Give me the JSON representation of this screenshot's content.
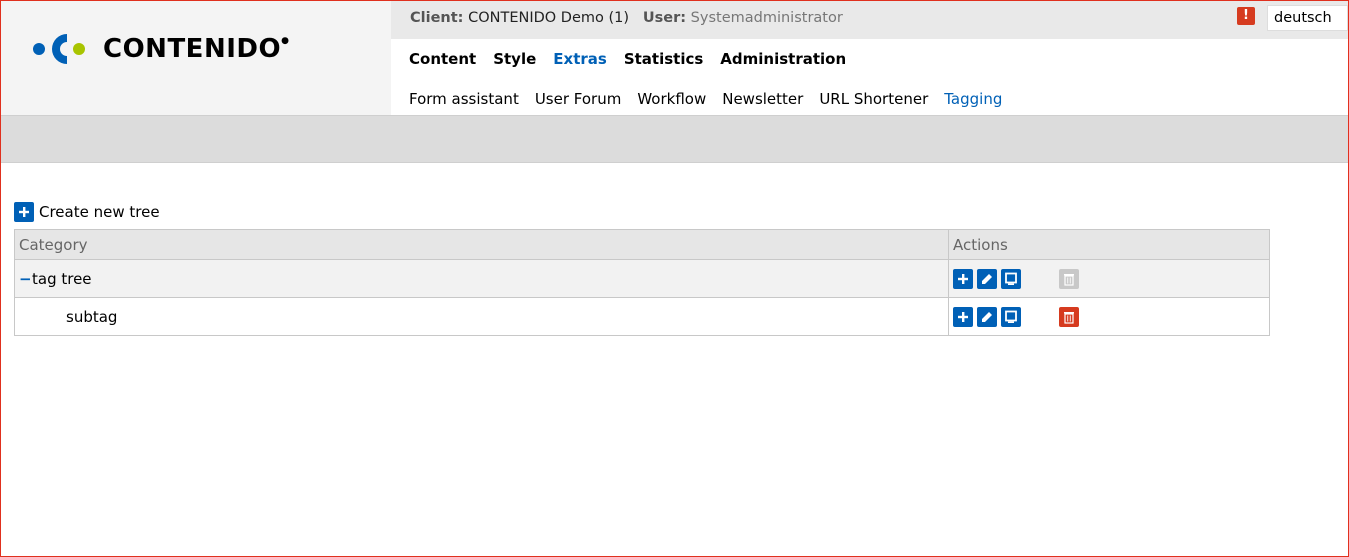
{
  "header": {
    "logo_text": "CONTENIDO",
    "client_label": "Client:",
    "client_value": "CONTENIDO Demo (1)",
    "user_label": "User:",
    "user_value": "Systemadministrator",
    "alert_icon": "!",
    "language": "deutsch"
  },
  "main_nav": [
    {
      "label": "Content",
      "active": false
    },
    {
      "label": "Style",
      "active": false
    },
    {
      "label": "Extras",
      "active": true
    },
    {
      "label": "Statistics",
      "active": false
    },
    {
      "label": "Administration",
      "active": false
    }
  ],
  "sub_nav": [
    {
      "label": "Form assistant",
      "active": false
    },
    {
      "label": "User Forum",
      "active": false
    },
    {
      "label": "Workflow",
      "active": false
    },
    {
      "label": "Newsletter",
      "active": false
    },
    {
      "label": "URL Shortener",
      "active": false
    },
    {
      "label": "Tagging",
      "active": true
    }
  ],
  "content": {
    "create_label": "Create new tree",
    "table": {
      "headers": {
        "category": "Category",
        "actions": "Actions"
      },
      "rows": [
        {
          "toggle": "−",
          "name": "tag tree",
          "delete_enabled": false
        },
        {
          "toggle": "",
          "name": "subtag",
          "delete_enabled": true
        }
      ]
    }
  },
  "colors": {
    "accent": "#0060b6",
    "danger": "#d63b1f",
    "disabled": "#c8c8c8",
    "logo_blue": "#0060b6",
    "logo_green": "#a8c400"
  },
  "icons": {
    "create": "plus-icon",
    "add_child": "plus-icon",
    "edit": "pencil-icon",
    "view": "monitor-icon",
    "delete": "trash-icon",
    "collapse": "minus-icon",
    "alert": "exclamation-icon"
  }
}
